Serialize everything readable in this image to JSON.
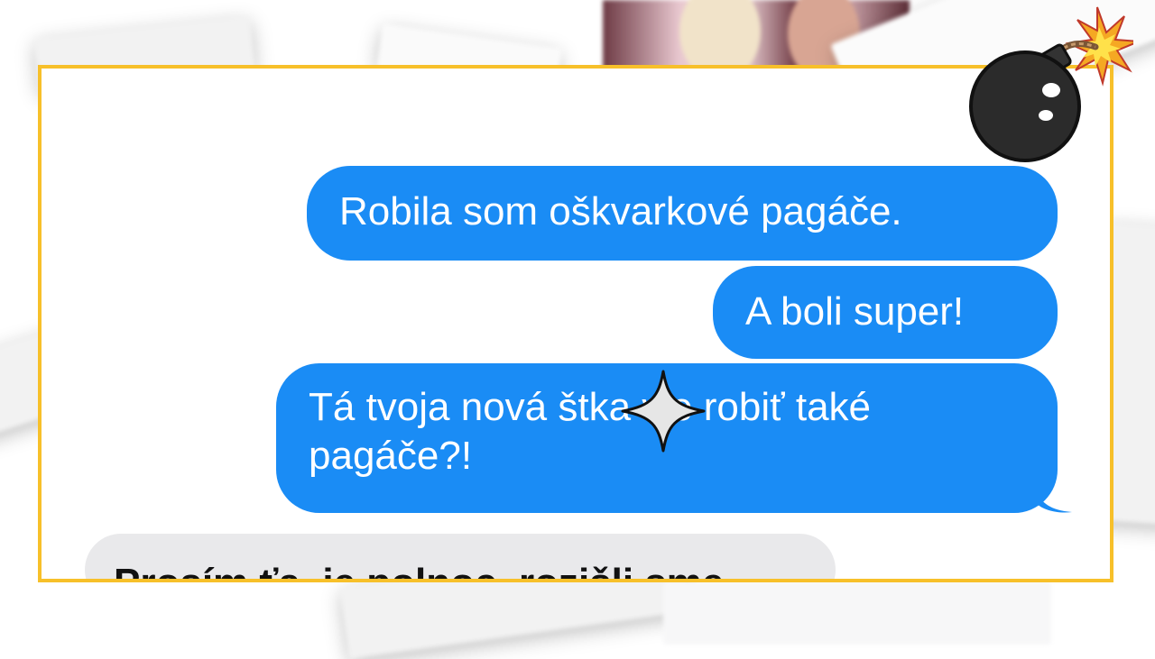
{
  "messages": {
    "sent": [
      "Robila som oškvarkové pagáče.",
      "A boli super!",
      "Tá tvoja nová št⁠ka vie robiť také\npagáče?!"
    ],
    "received": [
      "Prosím ťa, je polnoc, rozišli sme"
    ]
  },
  "colors": {
    "sent_bubble": "#1a8cf5",
    "received_bubble": "#e9e9eb",
    "frame_border": "#f7c02a"
  },
  "icons": [
    "sparkle-icon",
    "bomb-icon"
  ]
}
